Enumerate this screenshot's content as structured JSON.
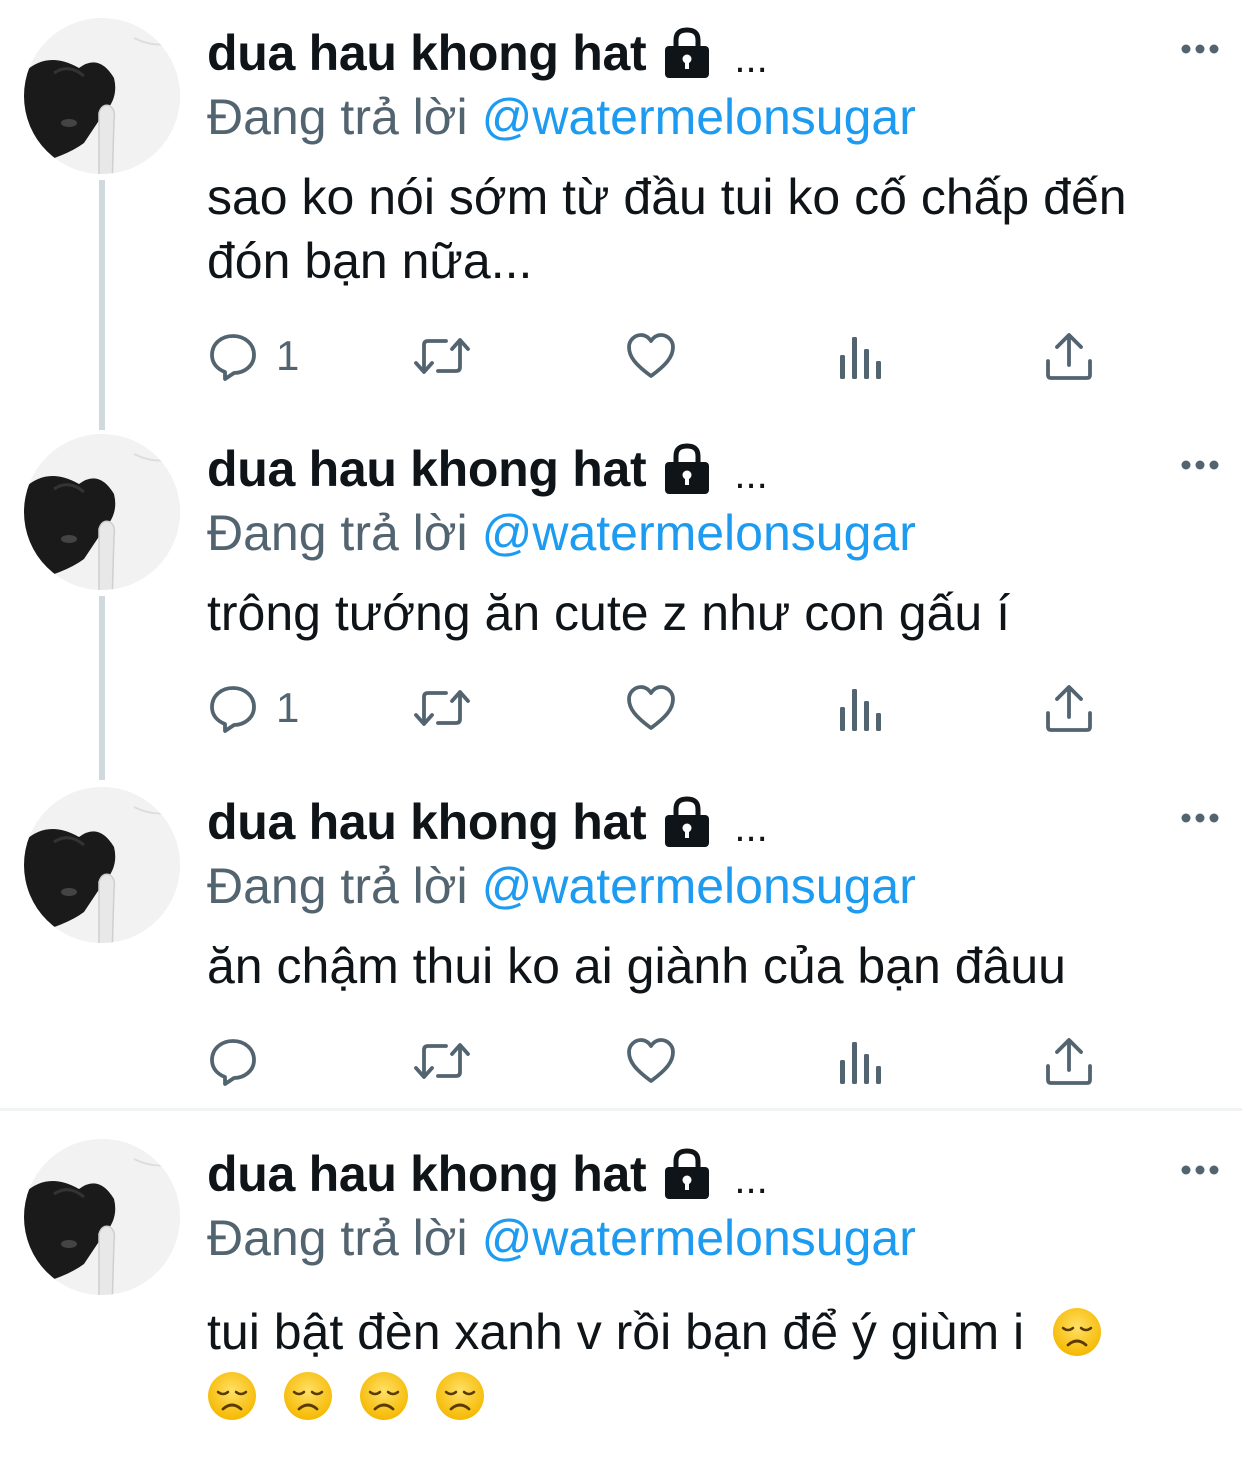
{
  "tweets": [
    {
      "name": "dua hau khong hat",
      "name_suffix": "...",
      "reply_prefix": "Đang trả lời",
      "reply_handle": "@watermelonsugar",
      "text": "sao ko nói sớm từ đầu tui ko cố chấp đến đón bạn nữa...",
      "reply_count": "1"
    },
    {
      "name": "dua hau khong hat",
      "name_suffix": "...",
      "reply_prefix": "Đang trả lời",
      "reply_handle": "@watermelonsugar",
      "text": "trông tướng ăn cute z như con gấu í",
      "reply_count": "1"
    },
    {
      "name": "dua hau khong hat",
      "name_suffix": "...",
      "reply_prefix": "Đang trả lời",
      "reply_handle": "@watermelonsugar",
      "text": "ăn chậm thui ko ai giành của bạn đâuu",
      "reply_count": ""
    },
    {
      "name": "dua hau khong hat",
      "name_suffix": "...",
      "reply_prefix": "Đang trả lời",
      "reply_handle": "@watermelonsugar",
      "text": "tui bật đèn xanh v rồi bạn để ý giùm i",
      "emoji": "disappointed-face",
      "emoji_count": 5
    }
  ],
  "icons": {
    "reply": "reply-icon",
    "retweet": "retweet-icon",
    "like": "heart-icon",
    "analytics": "analytics-icon",
    "share": "share-icon",
    "more": "more-icon",
    "lock": "lock-icon"
  },
  "colors": {
    "link": "#1d9bf0",
    "secondary_text": "#536471",
    "primary_text": "#0f1419",
    "thread_line": "#cfd9de"
  }
}
